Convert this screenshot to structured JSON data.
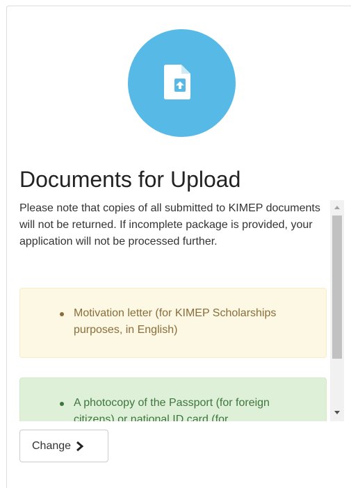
{
  "header": {
    "icon": "file-upload-icon",
    "accent_color": "#56b9e6",
    "title": "Documents for Upload"
  },
  "notice": {
    "text": "Please note that copies of all submitted to KIMEP documents will not be returned. If incomplete package is provided, your application will not be processed further."
  },
  "documents": [
    {
      "text": "Motivation letter (for KIMEP Scholarships purposes, in English)",
      "style": "warning",
      "color": "#fcf8e3"
    },
    {
      "text": "A photocopy of the Passport (for foreign citizens) or national ID card (for",
      "style": "success",
      "color": "#dff0d8"
    }
  ],
  "actions": {
    "change_label": "Change",
    "change_icon": "chevron-right-icon"
  }
}
